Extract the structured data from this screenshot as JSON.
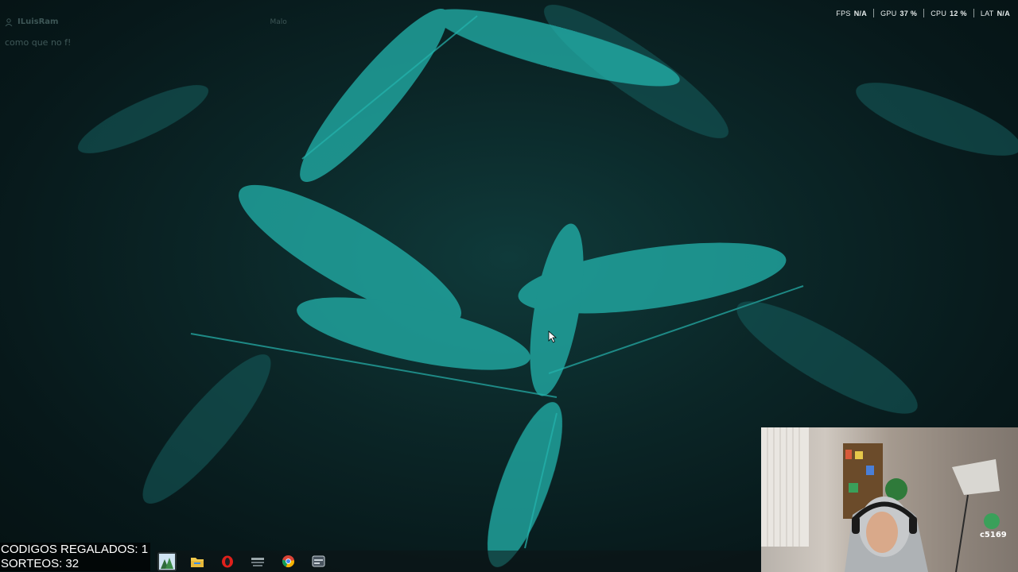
{
  "stats": {
    "fps_label": "FPS",
    "fps_value": "N/A",
    "gpu_label": "GPU",
    "gpu_value": "37 %",
    "cpu_label": "CPU",
    "cpu_value": "12 %",
    "lat_label": "LAT",
    "lat_value": "N/A"
  },
  "chat": {
    "username": "ILuisRam",
    "meta": "Malo",
    "message": "como que no f!"
  },
  "counters": {
    "codes": "CODIGOS REGALADOS: 1",
    "draws": "SORTEOS: 32"
  },
  "taskbar": {
    "items": [
      {
        "name": "wallpaper-app-icon",
        "active": true
      },
      {
        "name": "file-explorer-icon"
      },
      {
        "name": "opera-icon"
      },
      {
        "name": "app-launcher-icon"
      },
      {
        "name": "chrome-icon"
      },
      {
        "name": "app-window-icon"
      }
    ]
  },
  "webcam": {
    "badge": "c5169"
  },
  "colors": {
    "accent": "#23b3ad",
    "background": "#0b2627"
  }
}
